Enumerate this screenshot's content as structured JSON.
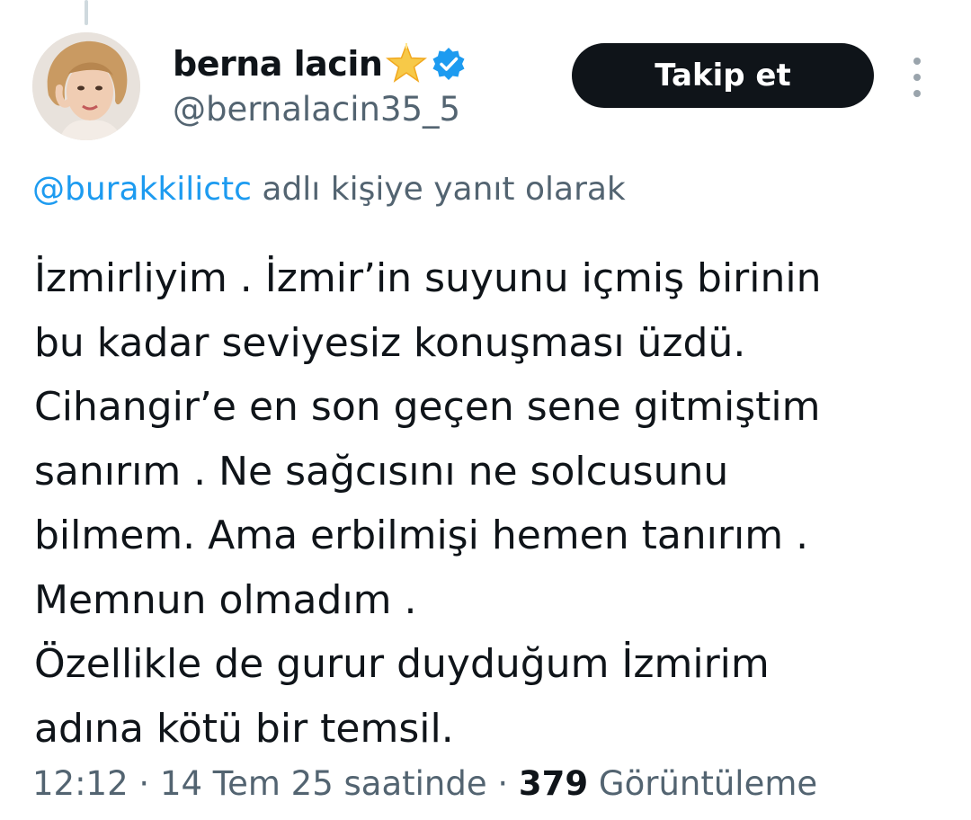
{
  "author": {
    "display_name": "berna lacin",
    "name_emoji": "star-emoji",
    "verified_badge": "verified-badge-icon",
    "handle": "@bernalacin35_5"
  },
  "follow_button_label": "Takip et",
  "reply_context": {
    "mention": "@burakkilictc",
    "suffix": " adlı kişiye yanıt olarak"
  },
  "tweet_lines": [
    "İzmirliyim . İzmir’in suyunu içmiş birinin",
    "bu kadar seviyesiz konuşması üzdü.",
    "Cihangir’e en son geçen sene gitmiştim",
    "sanırım . Ne sağcısını ne solcusunu",
    "bilmem. Ama erbilmişi hemen tanırım .",
    "Memnun olmadım .",
    "Özellikle de gurur duyduğum İzmirim",
    "adına kötü bir temsil."
  ],
  "meta": {
    "time": "12:12",
    "sep1": " · ",
    "date": "14 Tem 25 saatinde",
    "sep2": " · ",
    "views_count": "379",
    "views_label": " Görüntüleme"
  },
  "colors": {
    "accent": "#1d9bf0",
    "text_primary": "#0f1419",
    "text_secondary": "#536471",
    "button_bg": "#0f1419"
  }
}
